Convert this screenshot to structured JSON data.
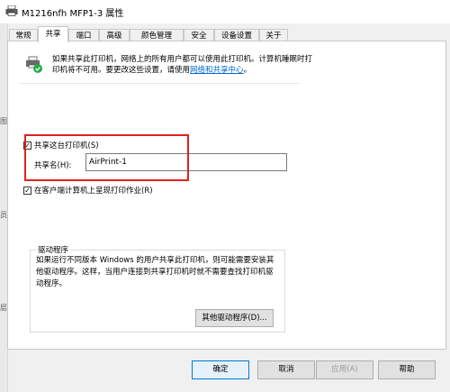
{
  "window": {
    "title": "M1216nfh MFP1-3 属性"
  },
  "tabs": [
    {
      "label": "常规"
    },
    {
      "label": "共享"
    },
    {
      "label": "端口"
    },
    {
      "label": "高级"
    },
    {
      "label": "颜色管理"
    },
    {
      "label": "安全"
    },
    {
      "label": "设备设置"
    },
    {
      "label": "关于"
    }
  ],
  "active_tab": "共享",
  "sharing": {
    "description": "如果共享此打印机，网络上的所有用户都可以使用此打印机。计算机睡眠时打印机将不可用。要更改这些设置，请使用",
    "link_text": "网络和共享中心",
    "link_suffix": "。",
    "share_checkbox_label": "共享这台打印机(S)",
    "share_checked": true,
    "share_name_label": "共享名(H):",
    "share_name_value": "AirPrint-1",
    "render_checkbox_label": "在客户端计算机上呈现打印作业(R)",
    "render_checked": true
  },
  "drivers": {
    "group_title": "驱动程序",
    "text": "如果运行不同版本 Windows 的用户共享此打印机，则可能需要安装其他驱动程序。这样，当用户连接到共享打印机时就不需要查找打印机驱动程序。",
    "button_label": "其他驱动程序(D)..."
  },
  "buttons": {
    "ok": "确定",
    "cancel": "取消",
    "apply": "应用(A)",
    "help": "帮助"
  },
  "background_window": {
    "fragments": [
      "图",
      "员",
      "层"
    ]
  },
  "colors": {
    "highlight": "#e02020",
    "link": "#0066cc",
    "default_button_border": "#0078d7"
  }
}
